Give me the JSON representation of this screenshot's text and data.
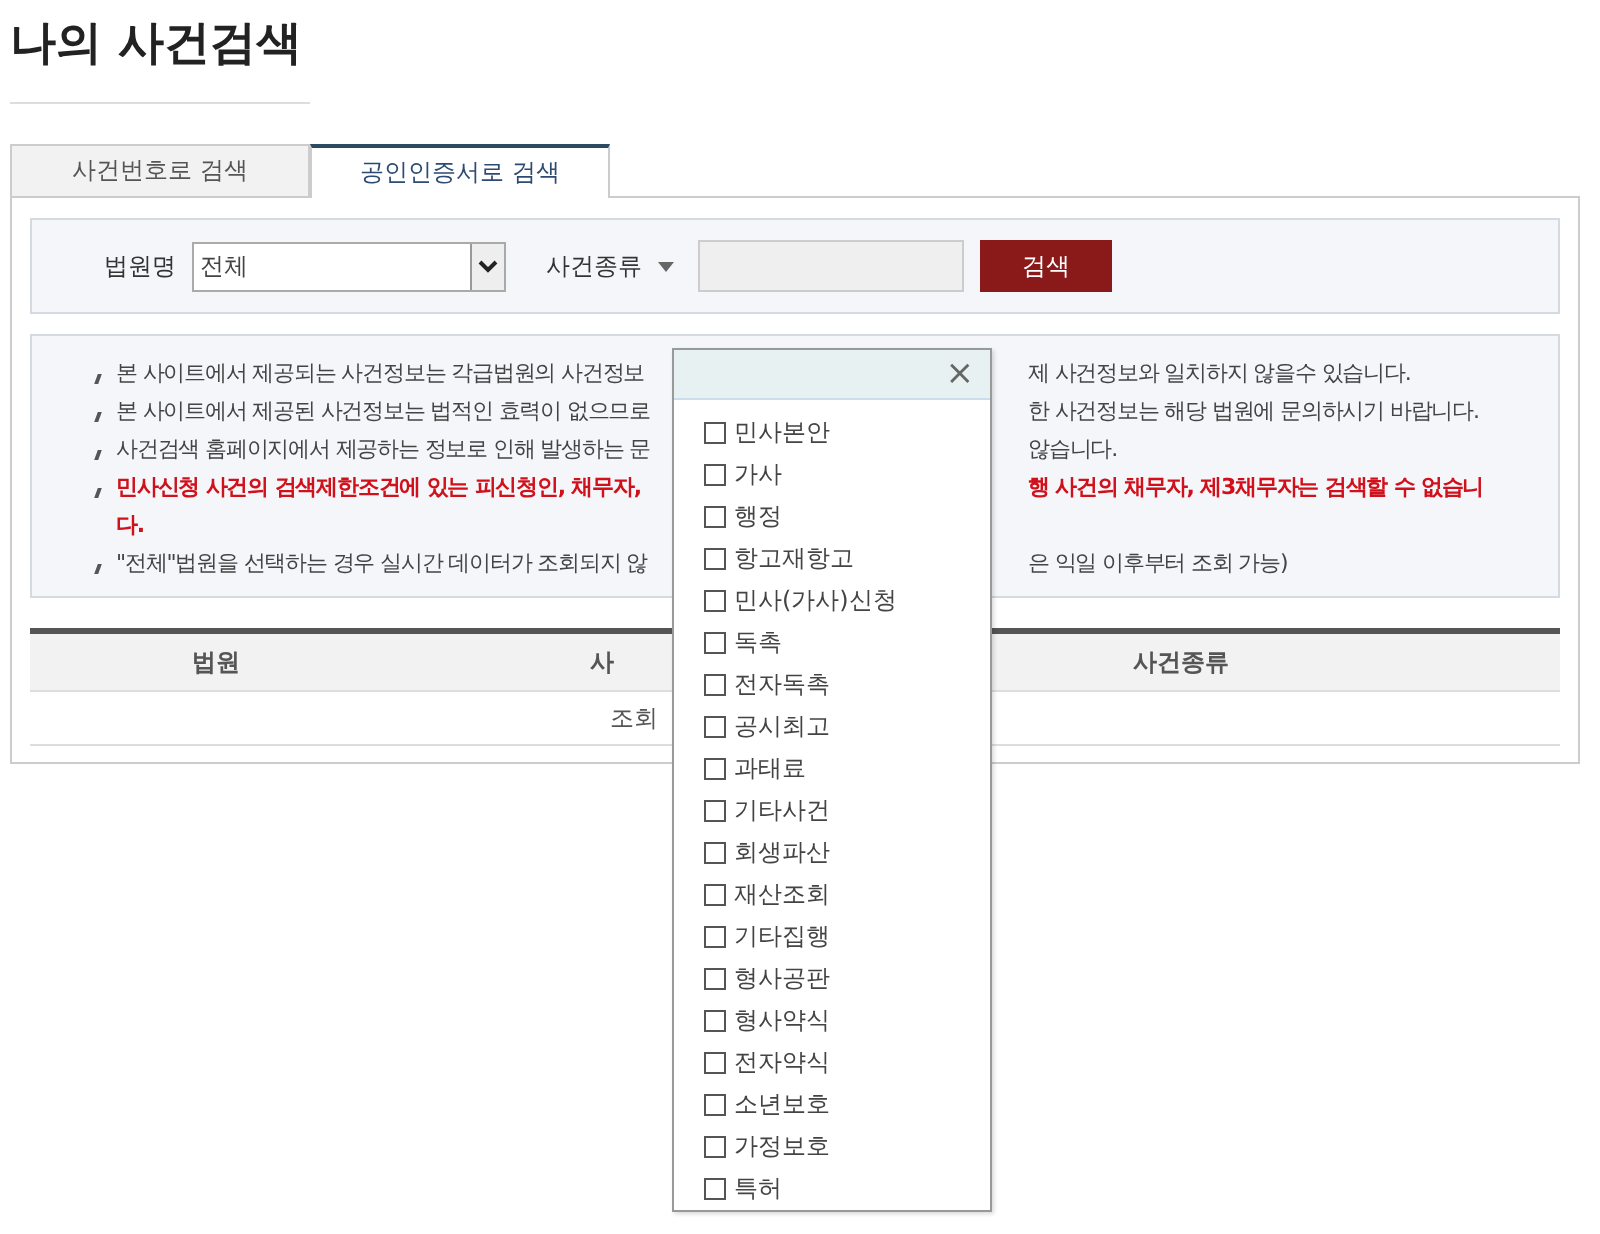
{
  "title": "나의 사건검색",
  "tabs": [
    {
      "label": "사건번호로 검색",
      "selected": false
    },
    {
      "label": "공인인증서로 검색",
      "selected": true
    }
  ],
  "search": {
    "court_label": "법원명",
    "court_value": "전체",
    "case_type_label": "사건종류",
    "search_button": "검색"
  },
  "notices": [
    {
      "left": "본 사이트에서 제공되는 사건정보는 각급법원의 사건정보",
      "right": "제 사건정보와 일치하지 않을수 있습니다.",
      "warning": false
    },
    {
      "left": "본 사이트에서 제공된 사건정보는 법적인 효력이 없으므로",
      "right": "한 사건정보는 해당 법원에 문의하시기 바랍니다.",
      "warning": false
    },
    {
      "left": "사건검색 홈페이지에서 제공하는 정보로 인해 발생하는 문",
      "right": "않습니다.",
      "warning": false
    },
    {
      "left": "민사신청 사건의 검색제한조건에 있는 피신청인, 채무자,",
      "right": "행 사건의 채무자, 제3채무자는 검색할 수 없습니",
      "continuation": "다.",
      "warning": true
    },
    {
      "left": "\"전체\"법원을 선택하는 경우 실시간 데이터가 조회되지 않",
      "right": "은 익일 이후부터 조회 가능)",
      "warning": false
    }
  ],
  "table": {
    "columns": [
      "법원",
      "사",
      "사건종류"
    ],
    "empty_message": "조회"
  },
  "case_type_popup": {
    "close": "×",
    "options": [
      {
        "label": "민사본안",
        "checked": false
      },
      {
        "label": "가사",
        "checked": false
      },
      {
        "label": "행정",
        "checked": false
      },
      {
        "label": "항고재항고",
        "checked": false
      },
      {
        "label": "민사(가사)신청",
        "checked": false
      },
      {
        "label": "독촉",
        "checked": false
      },
      {
        "label": "전자독촉",
        "checked": false
      },
      {
        "label": "공시최고",
        "checked": false
      },
      {
        "label": "과태료",
        "checked": false
      },
      {
        "label": "기타사건",
        "checked": false
      },
      {
        "label": "회생파산",
        "checked": false
      },
      {
        "label": "재산조회",
        "checked": false
      },
      {
        "label": "기타집행",
        "checked": false
      },
      {
        "label": "형사공판",
        "checked": false
      },
      {
        "label": "형사약식",
        "checked": false
      },
      {
        "label": "전자약식",
        "checked": false
      },
      {
        "label": "소년보호",
        "checked": false
      },
      {
        "label": "가정보호",
        "checked": false
      },
      {
        "label": "특허",
        "checked": false
      }
    ]
  }
}
